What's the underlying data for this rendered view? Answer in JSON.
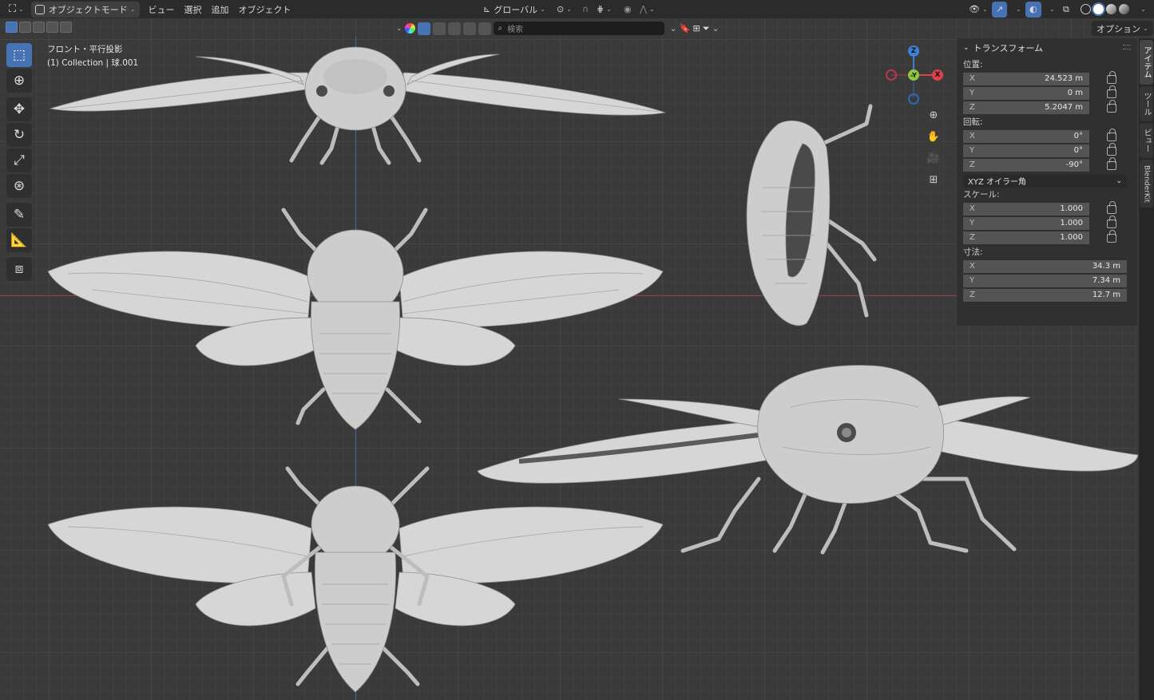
{
  "header": {
    "mode_label": "オブジェクトモード",
    "menu": [
      "ビュー",
      "選択",
      "追加",
      "オブジェクト"
    ],
    "orientation_label": "グローバル"
  },
  "subbar": {
    "search_placeholder": "検索",
    "options_label": "オプション"
  },
  "viewport": {
    "view_name": "フロント・平行投影",
    "collection_info": "(1) Collection | 球.001"
  },
  "gizmo": {
    "z": "Z",
    "y": "-Y",
    "x": "X"
  },
  "npanel": {
    "section_title": "トランスフォーム",
    "location_label": "位置:",
    "location": [
      {
        "axis": "X",
        "value": "24.523 m"
      },
      {
        "axis": "Y",
        "value": "0 m"
      },
      {
        "axis": "Z",
        "value": "5.2047 m"
      }
    ],
    "rotation_label": "回転:",
    "rotation": [
      {
        "axis": "X",
        "value": "0°"
      },
      {
        "axis": "Y",
        "value": "0°"
      },
      {
        "axis": "Z",
        "value": "-90°"
      }
    ],
    "rotation_mode": "XYZ オイラー角",
    "scale_label": "スケール:",
    "scale": [
      {
        "axis": "X",
        "value": "1.000"
      },
      {
        "axis": "Y",
        "value": "1.000"
      },
      {
        "axis": "Z",
        "value": "1.000"
      }
    ],
    "dimensions_label": "寸法:",
    "dimensions": [
      {
        "axis": "X",
        "value": "34.3 m"
      },
      {
        "axis": "Y",
        "value": "7.34 m"
      },
      {
        "axis": "Z",
        "value": "12.7 m"
      }
    ]
  },
  "sidetabs": [
    "アイテム",
    "ツール",
    "ビュー",
    "BlenderKit"
  ],
  "colors": {
    "accent": "#4772b3",
    "x_axis": "#e0404e",
    "y_axis": "#8cc73f",
    "z_axis": "#3b82d6"
  }
}
